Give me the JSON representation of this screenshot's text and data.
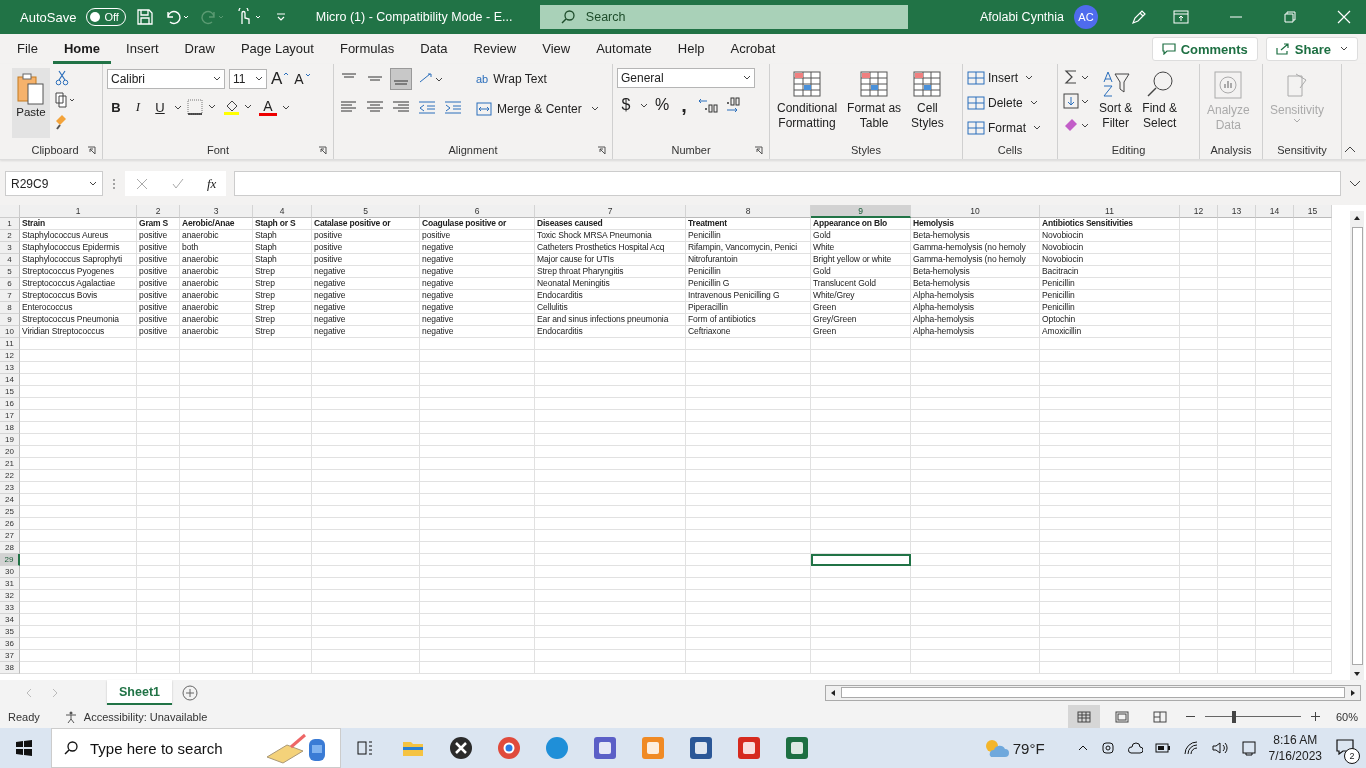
{
  "title_bar": {
    "autosave_label": "AutoSave",
    "autosave": {
      "on": false,
      "label": "Off"
    },
    "document_title": "Micro (1)  -  Compatibility Mode  -  E...",
    "search": {
      "placeholder": "Search"
    },
    "user_name": "Afolabi Cynthia",
    "avatar": "AC"
  },
  "menu_tabs": [
    {
      "label": "File",
      "selected": false
    },
    {
      "label": "Home",
      "selected": true
    },
    {
      "label": "Insert",
      "selected": false
    },
    {
      "label": "Draw",
      "selected": false
    },
    {
      "label": "Page Layout",
      "selected": false
    },
    {
      "label": "Formulas",
      "selected": false
    },
    {
      "label": "Data",
      "selected": false
    },
    {
      "label": "Review",
      "selected": false
    },
    {
      "label": "View",
      "selected": false
    },
    {
      "label": "Automate",
      "selected": false
    },
    {
      "label": "Help",
      "selected": false
    },
    {
      "label": "Acrobat",
      "selected": false
    }
  ],
  "comments": "Comments",
  "share": "Share",
  "ribbon": {
    "clipboard": {
      "paste": "Paste",
      "label": "Clipboard"
    },
    "font": {
      "name": "Calibri",
      "size": "11",
      "bold": "B",
      "italic": "I",
      "underline": "U",
      "grow": "A",
      "shrink": "A",
      "color_letter": "A",
      "label": "Font"
    },
    "alignment": {
      "wrap_icon": "ab",
      "wrap": "Wrap Text",
      "merge": "Merge & Center",
      "label": "Alignment"
    },
    "number": {
      "format": "General",
      "currency": "$",
      "percent": "%",
      "comma": ",",
      "label": "Number"
    },
    "styles": {
      "buttons": [
        [
          "Conditional",
          "Formatting"
        ],
        [
          "Format as",
          "Table"
        ],
        [
          "Cell",
          "Styles"
        ]
      ],
      "label": "Styles"
    },
    "cells": {
      "buttons": [
        "Insert",
        "Delete",
        "Format"
      ],
      "label": "Cells"
    },
    "editing": {
      "sort": [
        "Sort &",
        "Filter"
      ],
      "find": [
        "Find &",
        "Select"
      ],
      "label": "Editing"
    },
    "analysis": {
      "button": [
        "Analyze",
        "Data"
      ],
      "disabled": true,
      "label": "Analysis"
    },
    "sensitivity": {
      "button": "Sensitivity",
      "disabled": true,
      "label": "Sensitivity"
    }
  },
  "formula_bar": {
    "name_box": "R29C9",
    "fx": "fx"
  },
  "grid": {
    "columns": [
      {
        "label": "1",
        "selected": false
      },
      {
        "label": "2",
        "selected": false
      },
      {
        "label": "3",
        "selected": false
      },
      {
        "label": "4",
        "selected": false
      },
      {
        "label": "5",
        "selected": false
      },
      {
        "label": "6",
        "selected": false
      },
      {
        "label": "7",
        "selected": false
      },
      {
        "label": "8",
        "selected": false
      },
      {
        "label": "9",
        "selected": true
      },
      {
        "label": "10",
        "selected": false
      },
      {
        "label": "11",
        "selected": false
      },
      {
        "label": "12",
        "selected": false
      },
      {
        "label": "13",
        "selected": false
      },
      {
        "label": "14",
        "selected": false
      },
      {
        "label": "15",
        "selected": false
      }
    ],
    "rows": [
      {
        "label": "1",
        "selected": false,
        "kind": "header",
        "cells": [
          "Strain",
          "Gram S",
          "Aerobic/Anae",
          "Staph or S",
          "Catalase positive or",
          "Coagulase positive or",
          "Diseases caused",
          "Treatment",
          "Appearance on Blo",
          "Hemolysis",
          "Antibiotics Sensitivities"
        ]
      },
      {
        "label": "2",
        "selected": false,
        "kind": "data",
        "cells": [
          "Staphylococcus Aureus",
          "positive",
          "anaerobic",
          "Staph",
          "positive",
          "positive",
          "Toxic Shock MRSA Pneumonia",
          "Penicillin",
          "Gold",
          "Beta-hemolysis",
          "Novobiocin"
        ]
      },
      {
        "label": "3",
        "selected": false,
        "kind": "data",
        "cells": [
          "Staphylococcus Epidermis",
          "positive",
          "both",
          "Staph",
          "positive",
          "negative",
          "Catheters Prosthetics Hospital Acq",
          "Rifampin, Vancomycin, Penici",
          "White",
          "Gamma-hemolysis (no hemoly",
          "Novobiocin"
        ]
      },
      {
        "label": "4",
        "selected": false,
        "kind": "data",
        "cells": [
          "Staphylococcus Saprophyti",
          "positive",
          "anaerobic",
          "Staph",
          "positive",
          "negative",
          "Major cause for UTIs",
          "Nitrofurantoin",
          "Bright yellow or white",
          "Gamma-hemolysis (no hemoly",
          "Novobiocin"
        ]
      },
      {
        "label": "5",
        "selected": false,
        "kind": "data",
        "cells": [
          "Streptococcus Pyogenes",
          "positive",
          "anaerobic",
          "Strep",
          "negative",
          "negative",
          "Strep throat Pharyngitis",
          "Penicillin",
          "Gold",
          "Beta-hemolysis",
          "Bacitracin"
        ]
      },
      {
        "label": "6",
        "selected": false,
        "kind": "data",
        "cells": [
          "Streptococcus Agalactiae",
          "positive",
          "anaerobic",
          "Strep",
          "negative",
          "negative",
          "Neonatal Meningitis",
          "Penicillin G",
          "Translucent Gold",
          "Beta-hemolysis",
          "Penicillin"
        ]
      },
      {
        "label": "7",
        "selected": false,
        "kind": "data",
        "cells": [
          "Streptococcus Bovis",
          "positive",
          "anaerobic",
          "Strep",
          "negative",
          "negative",
          "Endocarditis",
          "Intravenous Penicilling G",
          "White/Grey",
          "Alpha-hemolysis",
          "Penicillin"
        ]
      },
      {
        "label": "8",
        "selected": false,
        "kind": "data",
        "cells": [
          "Enterococcus",
          "positive",
          "anaerobic",
          "Strep",
          "negative",
          "negative",
          "Cellulitis",
          "Piperacillin",
          "Green",
          "Alpha-hemolysis",
          "Penicillin"
        ]
      },
      {
        "label": "9",
        "selected": false,
        "kind": "data",
        "cells": [
          "Streptococcus Pneumonia",
          "positive",
          "anaerobic",
          "Strep",
          "negative",
          "negative",
          "Ear and sinus infections pneumonia",
          "Form of antibiotics",
          "Grey/Green",
          "Alpha-hemolysis",
          "Optochin"
        ]
      },
      {
        "label": "10",
        "selected": false,
        "kind": "data",
        "cells": [
          "Viridian Streptococcus",
          "positive",
          "anaerobic",
          "Strep",
          "negative",
          "negative",
          "Endocarditis",
          "Ceftriaxone",
          "Green",
          "Alpha-hemolysis",
          "Amoxicillin"
        ]
      },
      {
        "label": "11",
        "selected": false,
        "kind": "data"
      },
      {
        "label": "12",
        "selected": false,
        "kind": "data"
      },
      {
        "label": "13",
        "selected": false,
        "kind": "data"
      },
      {
        "label": "14",
        "selected": false,
        "kind": "data"
      },
      {
        "label": "15",
        "selected": false,
        "kind": "data"
      },
      {
        "label": "16",
        "selected": false,
        "kind": "data"
      },
      {
        "label": "17",
        "selected": false,
        "kind": "data"
      },
      {
        "label": "18",
        "selected": false,
        "kind": "data"
      },
      {
        "label": "19",
        "selected": false,
        "kind": "data"
      },
      {
        "label": "20",
        "selected": false,
        "kind": "data"
      },
      {
        "label": "21",
        "selected": false,
        "kind": "data"
      },
      {
        "label": "22",
        "selected": false,
        "kind": "data"
      },
      {
        "label": "23",
        "selected": false,
        "kind": "data"
      },
      {
        "label": "24",
        "selected": false,
        "kind": "data"
      },
      {
        "label": "25",
        "selected": false,
        "kind": "data"
      },
      {
        "label": "26",
        "selected": false,
        "kind": "data"
      },
      {
        "label": "27",
        "selected": false,
        "kind": "data"
      },
      {
        "label": "28",
        "selected": false,
        "kind": "data"
      },
      {
        "label": "29",
        "selected": true,
        "kind": "data"
      },
      {
        "label": "30",
        "selected": false,
        "kind": "data"
      },
      {
        "label": "31",
        "selected": false,
        "kind": "data"
      },
      {
        "label": "32",
        "selected": false,
        "kind": "data"
      },
      {
        "label": "33",
        "selected": false,
        "kind": "data"
      },
      {
        "label": "34",
        "selected": false,
        "kind": "data"
      },
      {
        "label": "35",
        "selected": false,
        "kind": "data"
      },
      {
        "label": "36",
        "selected": false,
        "kind": "data"
      },
      {
        "label": "37",
        "selected": false,
        "kind": "data"
      },
      {
        "label": "38",
        "selected": false,
        "kind": "data"
      }
    ]
  },
  "sheet_tabs": [
    {
      "label": "Sheet1",
      "selected": true
    }
  ],
  "status_bar": {
    "ready": "Ready",
    "accessibility": "Accessibility: Unavailable",
    "views": [
      {
        "kind": "normal",
        "selected": true
      },
      {
        "kind": "page_layout",
        "selected": false
      },
      {
        "kind": "page_break",
        "selected": false
      }
    ],
    "zoom_slider": {
      "level": 0.3
    },
    "zoom": "60%"
  },
  "taskbar": {
    "search_placeholder": "Type here to search",
    "apps": [
      {
        "kind": "task_view"
      },
      {
        "kind": "folder"
      },
      {
        "kind": "x_app"
      },
      {
        "kind": "chrome"
      },
      {
        "kind": "edge"
      },
      {
        "kind": "teams"
      },
      {
        "kind": "r_app"
      },
      {
        "kind": "word"
      },
      {
        "kind": "acrobat"
      },
      {
        "kind": "excel"
      }
    ],
    "weather": "79°F",
    "time": "8:16 AM",
    "date": "7/16/2023",
    "notifications": "2"
  }
}
